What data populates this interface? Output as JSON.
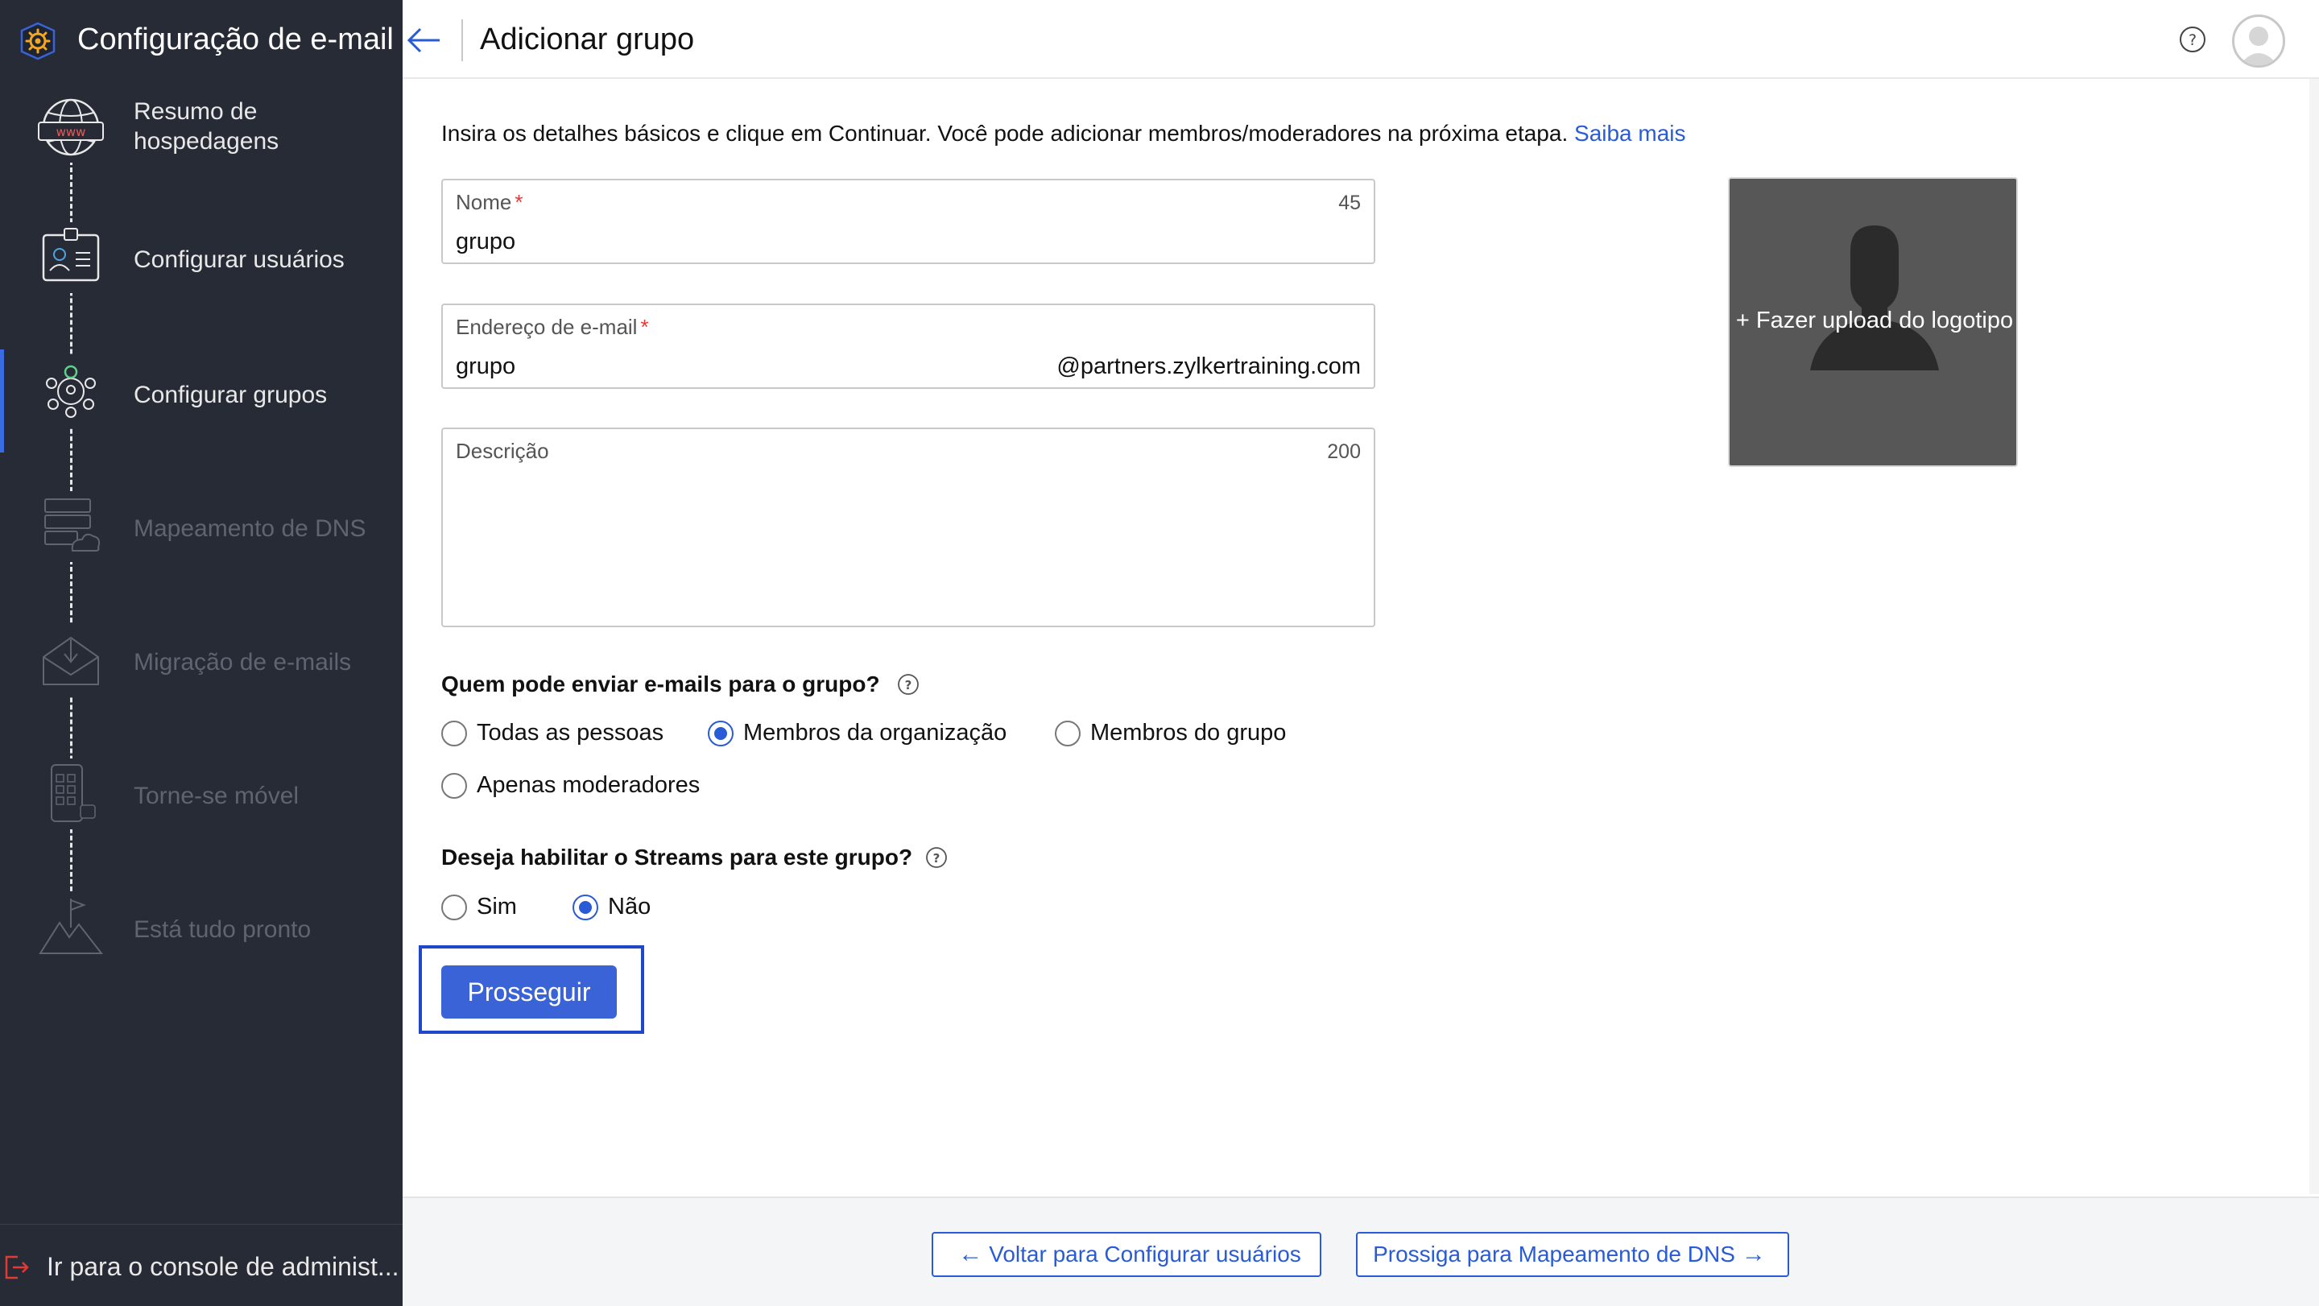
{
  "app": {
    "title": "Configuração de e-mail"
  },
  "sidebar": {
    "steps": [
      {
        "label": "Resumo de hospedagens",
        "state": "done",
        "icon": "www-globe-icon"
      },
      {
        "label": "Configurar usuários",
        "state": "done",
        "icon": "user-card-icon"
      },
      {
        "label": "Configurar grupos",
        "state": "active",
        "icon": "group-network-icon"
      },
      {
        "label": "Mapeamento de DNS",
        "state": "disabled",
        "icon": "dns-server-icon"
      },
      {
        "label": "Migração de e-mails",
        "state": "disabled",
        "icon": "mail-migration-icon"
      },
      {
        "label": "Torne-se móvel",
        "state": "disabled",
        "icon": "mobile-apps-icon"
      },
      {
        "label": "Está tudo pronto",
        "state": "disabled",
        "icon": "mountain-flag-icon"
      }
    ],
    "admin_link": "Ir para o console de administ..."
  },
  "header": {
    "title": "Adicionar grupo"
  },
  "intro": {
    "text": "Insira os detalhes básicos e clique em Continuar. Você pode adicionar membros/moderadores na próxima etapa.",
    "link": "Saiba mais"
  },
  "form": {
    "name": {
      "label": "Nome",
      "required": "*",
      "counter": "45",
      "value": "grupo"
    },
    "email": {
      "label": "Endereço de e-mail",
      "required": "*",
      "value": "grupo",
      "suffix": "@partners.zylkertraining.com"
    },
    "description": {
      "label": "Descrição",
      "counter": "200",
      "value": ""
    },
    "upload_label": "+ Fazer upload do logotipo"
  },
  "who_can_send": {
    "question": "Quem pode enviar e-mails para o grupo?",
    "options": [
      "Todas as pessoas",
      "Membros da organização",
      "Membros do grupo",
      "Apenas moderadores"
    ],
    "selected": "Membros da organização"
  },
  "streams": {
    "question": "Deseja habilitar o Streams para este grupo?",
    "options": [
      "Sim",
      "Não"
    ],
    "selected": "Não"
  },
  "actions": {
    "proceed": "Prosseguir"
  },
  "footer": {
    "back": "Voltar para Configurar usuários",
    "next": "Prossiga para Mapeamento de DNS"
  },
  "colors": {
    "sidebar_bg": "#272b36",
    "accent": "#3b63d8",
    "link": "#2a5bd7",
    "brand_icon": "#f5a623"
  }
}
